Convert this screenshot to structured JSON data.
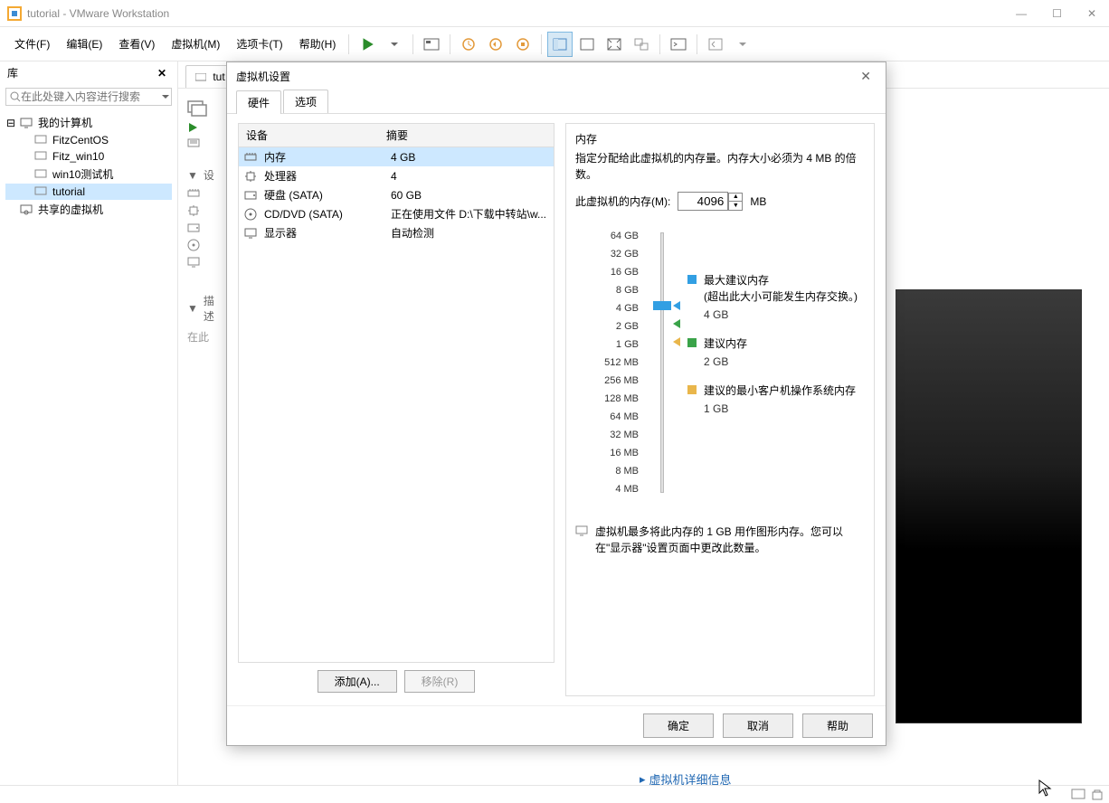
{
  "window": {
    "title": "tutorial - VMware Workstation",
    "minimize_tip": "—",
    "maximize_tip": "☐",
    "close_tip": "✕"
  },
  "menu": {
    "file": "文件(F)",
    "edit": "编辑(E)",
    "view": "查看(V)",
    "vm": "虚拟机(M)",
    "tabs": "选项卡(T)",
    "help": "帮助(H)"
  },
  "sidebar": {
    "title": "库",
    "search_placeholder": "在此处键入内容进行搜索",
    "root": "我的计算机",
    "items": [
      "FitzCentOS",
      "Fitz_win10",
      "win10测试机",
      "tutorial"
    ],
    "shared": "共享的虚拟机"
  },
  "tab_label": "tut",
  "side_headers": [
    "设",
    "描述"
  ],
  "side_desc_hint": "在此",
  "preview_alt": "虚拟机屏幕预览",
  "detail_link": "虚拟机详细信息",
  "dialog": {
    "title": "虚拟机设置",
    "tab_hw": "硬件",
    "tab_opt": "选项",
    "col_device": "设备",
    "col_summary": "摘要",
    "devices": [
      {
        "name": "内存",
        "summary": "4 GB",
        "icon": "memory"
      },
      {
        "name": "处理器",
        "summary": "4",
        "icon": "cpu"
      },
      {
        "name": "硬盘 (SATA)",
        "summary": "60 GB",
        "icon": "disk"
      },
      {
        "name": "CD/DVD (SATA)",
        "summary": "正在使用文件 D:\\下载中转站\\w...",
        "icon": "cd"
      },
      {
        "name": "显示器",
        "summary": "自动检测",
        "icon": "display"
      }
    ],
    "btn_add": "添加(A)...",
    "btn_remove": "移除(R)",
    "memory": {
      "heading": "内存",
      "desc": "指定分配给此虚拟机的内存量。内存大小必须为 4 MB 的倍数。",
      "label": "此虚拟机的内存(M):",
      "value": "4096",
      "unit": "MB",
      "scale": [
        "64 GB",
        "32 GB",
        "16 GB",
        "8 GB",
        "4 GB",
        "2 GB",
        "1 GB",
        "512 MB",
        "256 MB",
        "128 MB",
        "64 MB",
        "32 MB",
        "16 MB",
        "8 MB",
        "4 MB"
      ],
      "legend_max_title": "最大建议内存",
      "legend_max_note": "(超出此大小可能发生内存交换。)",
      "legend_max_val": "4 GB",
      "legend_rec_title": "建议内存",
      "legend_rec_val": "2 GB",
      "legend_min_title": "建议的最小客户机操作系统内存",
      "legend_min_val": "1 GB",
      "note": "虚拟机最多将此内存的 1 GB 用作图形内存。您可以在\"显示器\"设置页面中更改此数量。"
    },
    "btn_ok": "确定",
    "btn_cancel": "取消",
    "btn_help": "帮助"
  }
}
